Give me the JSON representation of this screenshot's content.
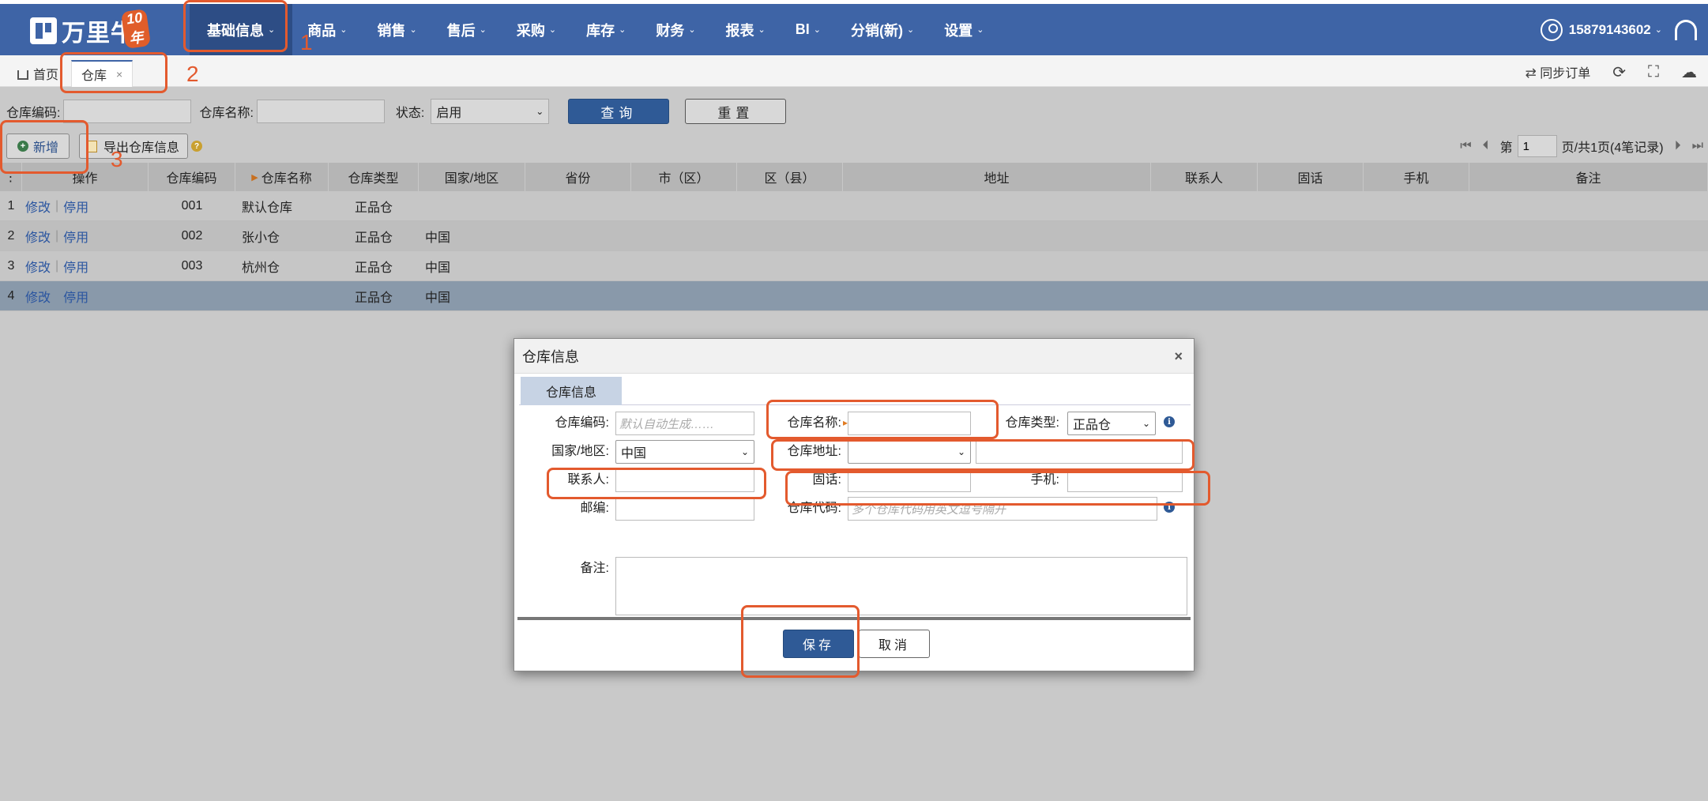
{
  "app": {
    "logo_text": "万里牛",
    "logo_badge": "10年",
    "nav": [
      {
        "label": "基础信息",
        "active": true
      },
      {
        "label": "商品"
      },
      {
        "label": "销售"
      },
      {
        "label": "售后"
      },
      {
        "label": "采购"
      },
      {
        "label": "库存"
      },
      {
        "label": "财务"
      },
      {
        "label": "报表"
      },
      {
        "label": "BI"
      },
      {
        "label": "分销(新)"
      },
      {
        "label": "设置"
      }
    ],
    "user": "15879143602"
  },
  "tabs": {
    "home": "首页",
    "active": "仓库",
    "close": "×"
  },
  "toolbar_right": {
    "sync_orders": "同步订单"
  },
  "search": {
    "code_label": "仓库编码:",
    "name_label": "仓库名称:",
    "status_label": "状态:",
    "status_value": "启用",
    "query_btn": "查询",
    "reset_btn": "重置"
  },
  "actions": {
    "add_btn": "新增",
    "export_btn": "导出仓库信息"
  },
  "pager": {
    "page_prefix": "第",
    "page_value": "1",
    "page_suffix": "页/共1页(4笔记录)"
  },
  "grid": {
    "headers": [
      "操作",
      "仓库编码",
      "仓库名称",
      "仓库类型",
      "国家/地区",
      "省份",
      "市（区）",
      "区（县）",
      "地址",
      "联系人",
      "固话",
      "手机",
      "备注"
    ],
    "edit_link": "修改",
    "disable_link": "停用",
    "rows": [
      {
        "idx": "1",
        "code": "001",
        "name": "默认仓库",
        "type": "正品仓",
        "country": ""
      },
      {
        "idx": "2",
        "code": "002",
        "name": "张小仓",
        "type": "正品仓",
        "country": "中国"
      },
      {
        "idx": "3",
        "code": "003",
        "name": "杭州仓",
        "type": "正品仓",
        "country": "中国"
      },
      {
        "idx": "4",
        "code": "",
        "name": "",
        "type": "正品仓",
        "country": "中国"
      }
    ]
  },
  "dialog": {
    "title": "仓库信息",
    "tab": "仓库信息",
    "close": "×",
    "code_label": "仓库编码:",
    "code_placeholder": "默认自动生成……",
    "name_label": "仓库名称:",
    "type_label": "仓库类型:",
    "type_value": "正品仓",
    "country_label": "国家/地区:",
    "country_value": "中国",
    "address_label": "仓库地址:",
    "contact_label": "联系人:",
    "phone_label": "固话:",
    "mobile_label": "手机:",
    "zip_label": "邮编:",
    "wh_code_label": "仓库代码:",
    "wh_code_placeholder": "多个仓库代码用英文逗号隔开",
    "remark_label": "备注:",
    "save_btn": "保存",
    "cancel_btn": "取消"
  },
  "annotations": [
    "1",
    "2",
    "3"
  ],
  "colors": {
    "nav_bg": "#3e64a6",
    "primary_btn": "#2f5a96",
    "highlight": "#e35a2e"
  }
}
